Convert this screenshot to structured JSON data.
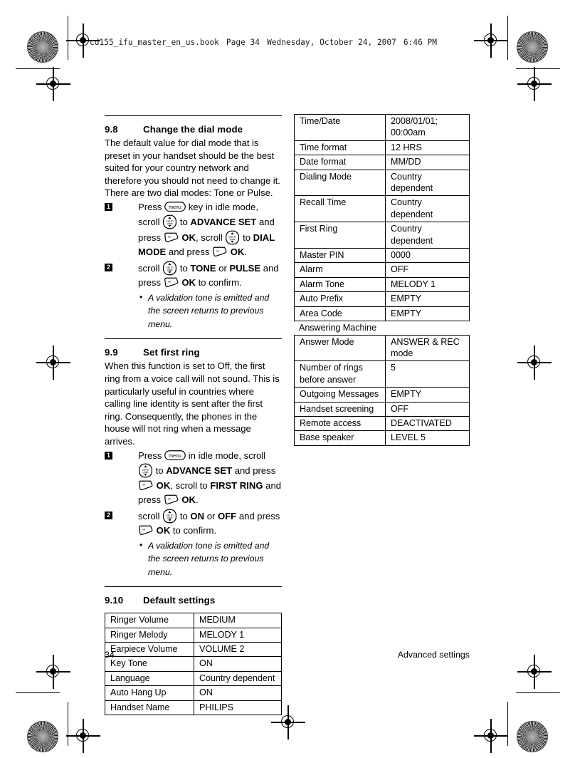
{
  "header": {
    "file": "cd155_ifu_master_en_us.book",
    "page": "Page 34",
    "weekday": "Wednesday, October 24, 2007",
    "time": "6:46 PM"
  },
  "icons": {
    "menu": "menu-key-icon",
    "scroll": "scroll-key-icon",
    "ok": "ok-softkey-icon",
    "scroll_up_label": "call ID",
    "scroll_down_label": "phbk",
    "menu_label": "menu",
    "ok_label": "ok"
  },
  "sections": [
    {
      "number": "9.8",
      "title": "Change the dial mode",
      "intro": "The default value for dial mode that is preset in your handset should be the best suited for your country network and therefore you should not need to change it. There are two dial modes: Tone or Pulse.",
      "steps": [
        {
          "num": "1"
        },
        {
          "num": "2"
        }
      ],
      "note": "A validation tone is emitted and the screen returns to previous menu."
    },
    {
      "number": "9.9",
      "title": "Set first ring",
      "intro": "When this function is set to Off, the first ring from a voice call will not sound. This is particularly useful in countries where calling line identity is sent after the first ring. Consequently, the phones in the house will not ring when a message arrives.",
      "note": "A validation tone is emitted and the screen returns to previous menu."
    },
    {
      "number": "9.10",
      "title": "Default settings"
    }
  ],
  "text_fragments": {
    "press": "Press",
    "key_in_idle_scroll": "key in idle mode, scroll",
    "in_idle_scroll": "in idle mode, scroll",
    "to": "to",
    "and_press": "and press",
    "scroll_word": "scroll",
    "scroll_to": "scroll to",
    "and_press_lc": "and press",
    "or": "or",
    "and": "and",
    "press_lc": "press",
    "to_confirm": "to confirm.",
    "comma": ",",
    "period": ".",
    "advance_set": "ADVANCE SET",
    "dial_mode": "DIAL MODE",
    "first_ring": "FIRST RING",
    "tone": "TONE",
    "pulse": "PULSE",
    "on": "ON",
    "off": "OFF",
    "ok": "OK"
  },
  "default_settings_table": {
    "rows": [
      {
        "key": "Ringer Volume",
        "value": "MEDIUM"
      },
      {
        "key": "Ringer Melody",
        "value": "MELODY 1"
      },
      {
        "key": "Earpiece Volume",
        "value": "VOLUME 2"
      },
      {
        "key": "Key Tone",
        "value": "ON"
      },
      {
        "key": "Language",
        "value": "Country  dependent"
      },
      {
        "key": "Auto Hang Up",
        "value": "ON"
      },
      {
        "key": "Handset Name",
        "value": "PHILIPS"
      }
    ]
  },
  "right_table": {
    "rows": [
      {
        "key": "Time/Date",
        "value": "2008/01/01; 00:00am"
      },
      {
        "key": "Time format",
        "value": "12 HRS"
      },
      {
        "key": "Date format",
        "value": "MM/DD"
      },
      {
        "key": "Dialing Mode",
        "value": "Country  dependent"
      },
      {
        "key": "Recall Time",
        "value": "Country  dependent"
      },
      {
        "key": "First Ring",
        "value": "Country  dependent"
      },
      {
        "key": "Master PIN",
        "value": "0000"
      },
      {
        "key": "Alarm",
        "value": "OFF"
      },
      {
        "key": "Alarm Tone",
        "value": "MELODY 1"
      },
      {
        "key": "Auto Prefix",
        "value": "EMPTY"
      },
      {
        "key": "Area Code",
        "value": "EMPTY"
      }
    ]
  },
  "answering_machine": {
    "caption": "Answering Machine",
    "rows": [
      {
        "key": "Answer Mode",
        "value": "ANSWER & REC mode"
      },
      {
        "key": "Number of rings before answer",
        "value": "5"
      },
      {
        "key": "Outgoing Messages",
        "value": "EMPTY"
      },
      {
        "key": "Handset screening",
        "value": "OFF"
      },
      {
        "key": "Remote access",
        "value": "DEACTIVATED"
      },
      {
        "key": "Base speaker",
        "value": "LEVEL 5"
      }
    ]
  },
  "footer": {
    "page_number": "34",
    "chapter": "Advanced settings"
  }
}
